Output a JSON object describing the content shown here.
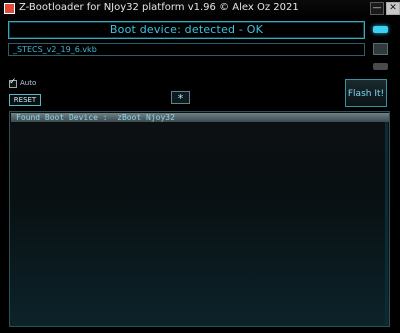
{
  "window": {
    "title": "Z-Bootloader for NJoy32 platform v1.96 © Alex Oz 2021",
    "minimize_label": "—",
    "close_label": "✕"
  },
  "status": {
    "text": "Boot device: detected - OK",
    "led_on_color": "#3ed0f2",
    "led_off_color": "#4a4a4a"
  },
  "file": {
    "name": "_STECS_v2_19_6.vkb"
  },
  "controls": {
    "auto_label": "Auto",
    "auto_checked": true,
    "reset_label": "RESET",
    "star_label": "*",
    "flash_label": "Flash It!"
  },
  "log": {
    "lines": [
      "Found Boot Device :  zBoot Njoy32"
    ]
  },
  "colors": {
    "accent": "#39c6e6",
    "background": "#000000"
  }
}
